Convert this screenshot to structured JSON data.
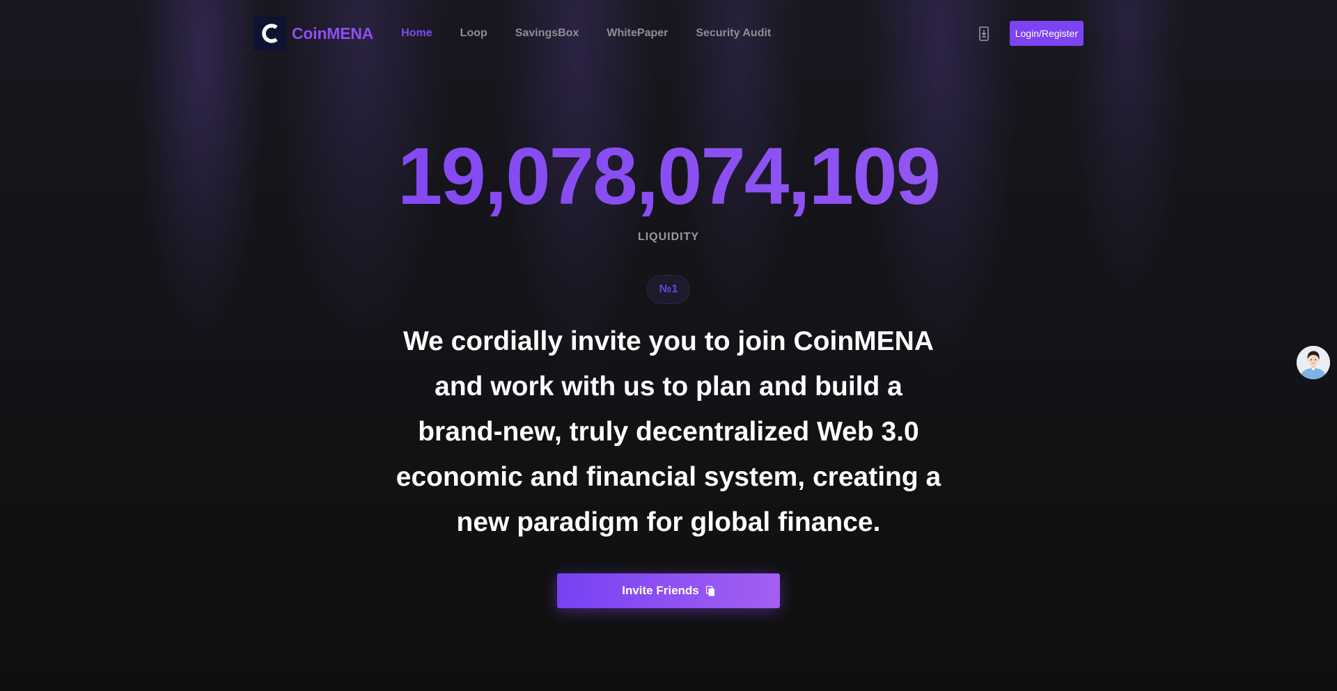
{
  "brand": {
    "name": "CoinMENA",
    "logo_letter": "C",
    "accent_color": "#7b43f2",
    "logo_bg_color": "#0d1330"
  },
  "nav": {
    "links": [
      {
        "label": "Home",
        "active": true
      },
      {
        "label": "Loop",
        "active": false
      },
      {
        "label": "SavingsBox",
        "active": false
      },
      {
        "label": "WhitePaper",
        "active": false
      },
      {
        "label": "Security Audit",
        "active": false
      }
    ],
    "app_download_icon": "mobile-download-icon",
    "login_label": "Login/Register"
  },
  "hero": {
    "liquidity_value": "19,078,074,109",
    "liquidity_label": "LIQUIDITY",
    "rank_badge": "№1",
    "headline": "We cordially invite you to join CoinMENA and work with us to plan and build a brand-new, truly decentralized Web 3.0 economic and financial system, creating a new paradigm for global finance.",
    "invite_label": "Invite Friends",
    "invite_icon": "copy-icon"
  },
  "support": {
    "avatar_icon": "support-agent-avatar"
  }
}
